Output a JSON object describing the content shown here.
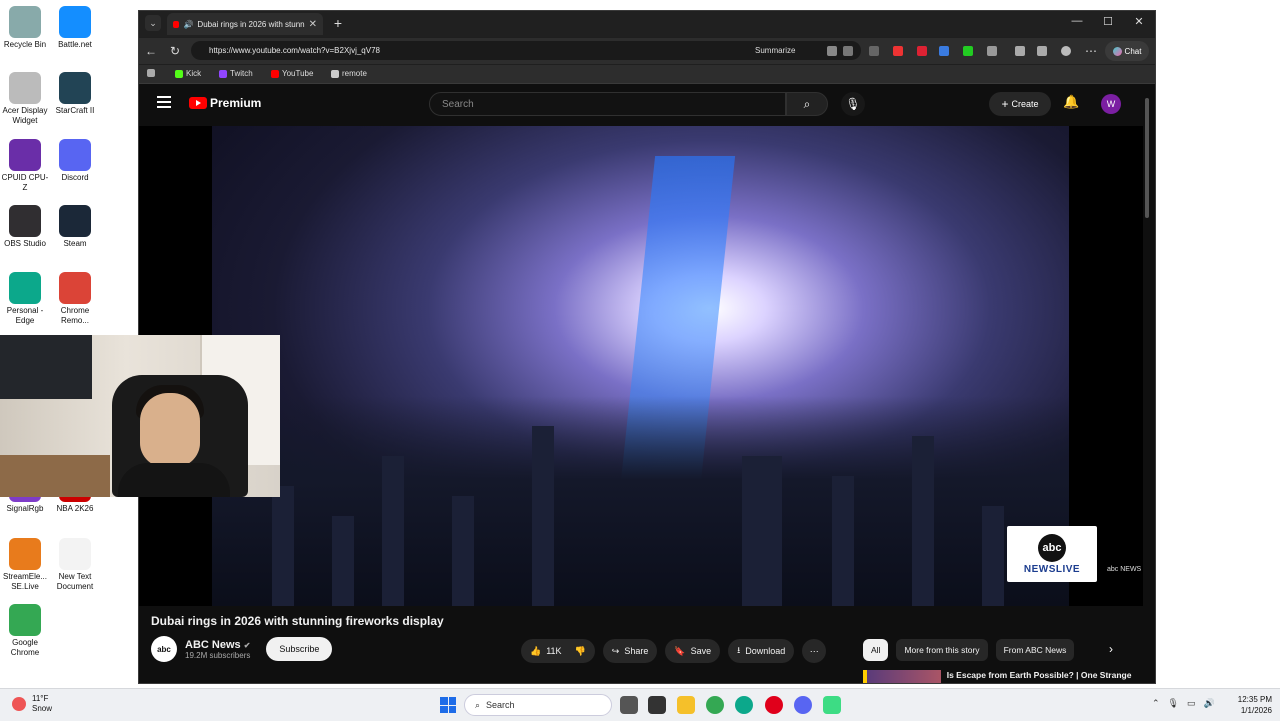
{
  "desktop": {
    "icons": [
      {
        "label": "Recycle Bin",
        "icon": "recycle-bin-icon",
        "color": "#8aa"
      },
      {
        "label": "Battle.net",
        "icon": "battlenet-icon",
        "color": "#148eff"
      },
      {
        "label": "Acer Display Widget",
        "icon": "acer-icon",
        "color": "#bbb"
      },
      {
        "label": "StarCraft II",
        "icon": "starcraft-icon",
        "color": "#245"
      },
      {
        "label": "CPUID CPU-Z",
        "icon": "cpuz-icon",
        "color": "#6a2ea8"
      },
      {
        "label": "Discord",
        "icon": "discord-icon",
        "color": "#5865f2"
      },
      {
        "label": "OBS Studio",
        "icon": "obs-icon",
        "color": "#302e31"
      },
      {
        "label": "Steam",
        "icon": "steam-icon",
        "color": "#1b2838"
      },
      {
        "label": "Personal - Edge",
        "icon": "edge-icon",
        "color": "#0ca88b"
      },
      {
        "label": "Chrome Remo...",
        "icon": "chrome-remote-icon",
        "color": "#db4437"
      },
      {
        "label": "SignalRgb",
        "icon": "signalrgb-icon",
        "color": "#7e3cc9"
      },
      {
        "label": "NBA 2K26",
        "icon": "nba2k-icon",
        "color": "#c00"
      },
      {
        "label": "StreamEle... SE.Live",
        "icon": "streamelements-icon",
        "color": "#e87b1c"
      },
      {
        "label": "New Text Document",
        "icon": "text-document-icon",
        "color": "#f3f3f3"
      },
      {
        "label": "Google Chrome",
        "icon": "chrome-icon",
        "color": "#34a853"
      }
    ]
  },
  "browser": {
    "tab_title": "Dubai rings in 2026 with stunn",
    "url": "https://www.youtube.com/watch?v=B2Xjvj_qV78",
    "summarize_label": "Summarize",
    "chat_label": "Chat",
    "favorites": [
      {
        "label": "Kick",
        "color": "#53fc18"
      },
      {
        "label": "Twitch",
        "color": "#9146ff"
      },
      {
        "label": "YouTube",
        "color": "#ff0000"
      },
      {
        "label": "remote",
        "color": "#cccccc"
      }
    ]
  },
  "youtube": {
    "logo_text": "Premium",
    "search_placeholder": "Search",
    "create_label": "Create",
    "avatar_letter": "W",
    "video": {
      "title": "Dubai rings in 2026 with stunning fireworks display",
      "channel": "ABC News",
      "channel_avatar": "abc",
      "subscribers": "19.2M subscribers",
      "subscribe_label": "Subscribe",
      "likes": "11K",
      "share_label": "Share",
      "save_label": "Save",
      "download_label": "Download",
      "badge_abc": "abc",
      "badge_text": "NEWSLIVE",
      "watermark": "abc NEWS"
    },
    "chips": [
      "All",
      "More from this story",
      "From ABC News"
    ],
    "recommendation_title": "Is Escape from Earth Possible? | One Strange Rock Ft. Will Smit"
  },
  "taskbar": {
    "temperature": "11°F",
    "weather": "Snow",
    "search_label": "Search",
    "time": "12:35 PM",
    "date": "1/1/2026"
  }
}
